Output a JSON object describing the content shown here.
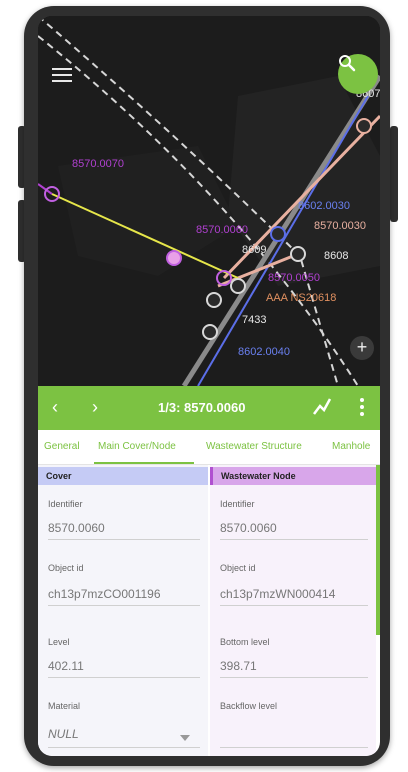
{
  "map": {
    "labels": {
      "l1": "8570.0070",
      "l2": "8570.0060",
      "l3": "8602.0030",
      "l4": "8570.0030",
      "l5": "8609",
      "l6": "8608",
      "l7": "8570.0050",
      "l8": "AAA NS20618",
      "l9": "7433",
      "l10": "8602.0040",
      "l11": "8607"
    },
    "zoom_in_label": "+"
  },
  "toolbar": {
    "prev": "‹",
    "next": "›",
    "title": "1/3: 8570.0060"
  },
  "tabs": [
    "General",
    "Main Cover/Node",
    "Wastewater Structure",
    "Manhole"
  ],
  "cover": {
    "header": "Cover",
    "identifier_label": "Identifier",
    "identifier_value": "8570.0060",
    "objectid_label": "Object id",
    "objectid_value": "ch13p7mzCO001196",
    "level_label": "Level",
    "level_value": "402.11",
    "material_label": "Material",
    "material_value": "NULL"
  },
  "node": {
    "header": "Wastewater Node",
    "identifier_label": "Identifier",
    "identifier_value": "8570.0060",
    "objectid_label": "Object id",
    "objectid_value": "ch13p7mzWN000414",
    "bottom_label": "Bottom level",
    "bottom_value": "398.71",
    "backflow_label": "Backflow level",
    "backflow_value": ""
  },
  "colors": {
    "accent": "#7cc242",
    "cover_header": "#c5cbf5",
    "node_header": "#d8a6ea"
  }
}
